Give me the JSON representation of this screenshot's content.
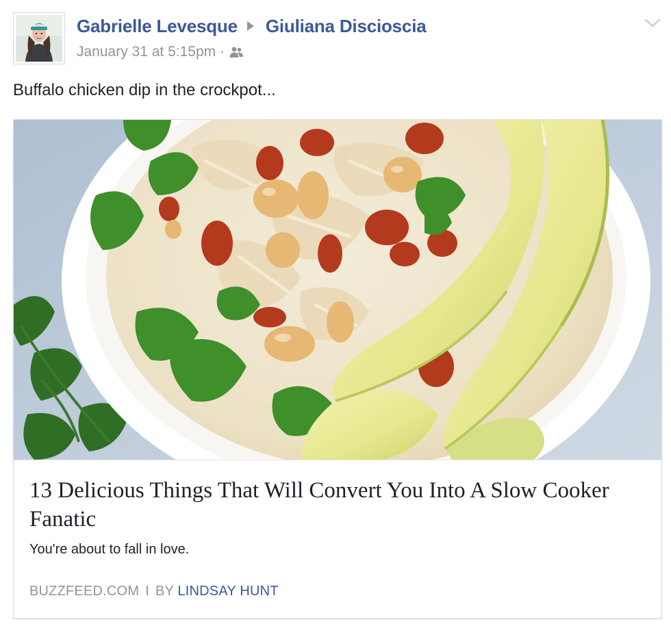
{
  "post": {
    "author": "Gabrielle Levesque",
    "recipient": "Giuliana Discioscia",
    "timestamp": "January 31 at 5:15pm",
    "separator": "·",
    "audience_icon": "friends-icon",
    "options_icon": "chevron-down-icon",
    "message": "Buffalo chicken dip in the crockpot..."
  },
  "link_card": {
    "image_alt": "bowl of white chicken chili with beans, cilantro and avocado",
    "title": "13 Delicious Things That Will Convert You Into A Slow Cooker Fanatic",
    "description": "You're about to fall in love.",
    "source": "BUZZFEED.COM",
    "source_separator": "I",
    "byline_prefix": "BY",
    "byline_author": "LINDSAY HUNT"
  },
  "colors": {
    "link_blue": "#3b5998",
    "meta_gray": "#90949c",
    "text_dark": "#1d2129",
    "card_border": "#d9dbe0"
  }
}
